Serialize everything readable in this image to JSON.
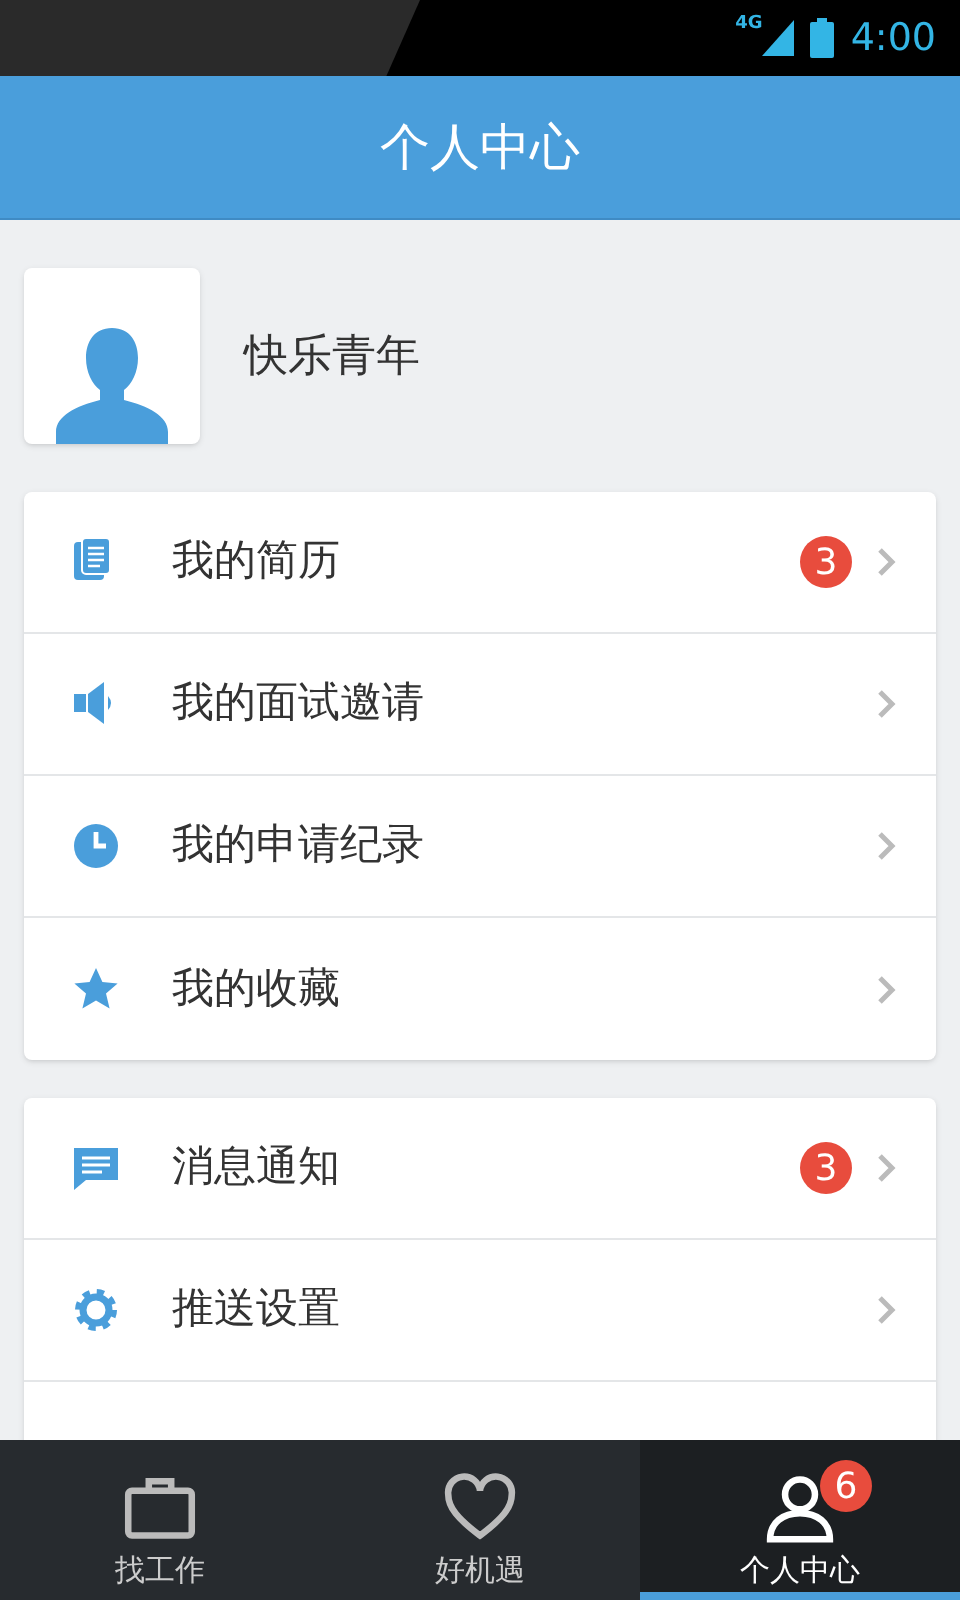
{
  "status_bar": {
    "network": "4G",
    "time": "4:00"
  },
  "header": {
    "title": "个人中心"
  },
  "profile": {
    "name": "快乐青年"
  },
  "groups": [
    {
      "items": [
        {
          "label": "我的简历",
          "badge": "3"
        },
        {
          "label": "我的面试邀请"
        },
        {
          "label": "我的申请纪录"
        },
        {
          "label": "我的收藏"
        }
      ]
    },
    {
      "items": [
        {
          "label": "消息通知",
          "badge": "3"
        },
        {
          "label": "推送设置"
        }
      ]
    }
  ],
  "tabs": [
    {
      "label": "找工作",
      "selected": false
    },
    {
      "label": "好机遇",
      "selected": false
    },
    {
      "label": "个人中心",
      "selected": true,
      "badge": "6"
    }
  ]
}
